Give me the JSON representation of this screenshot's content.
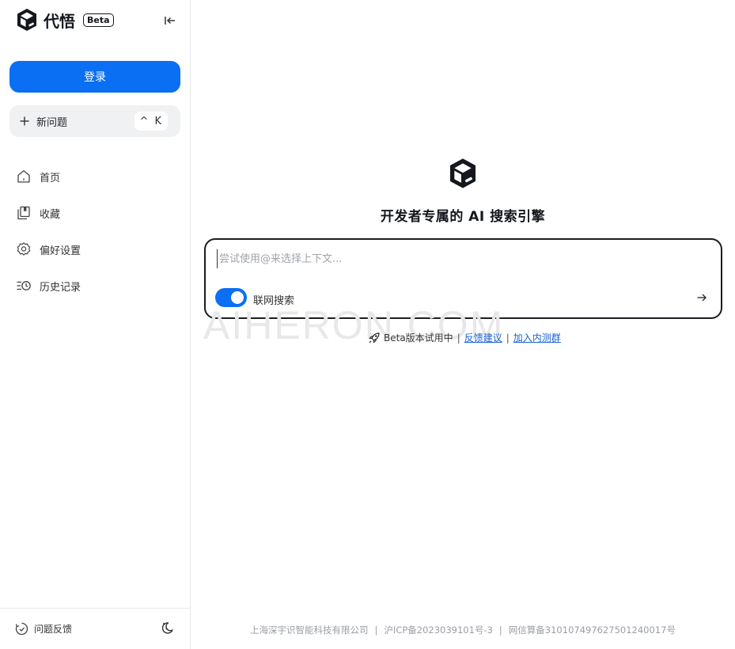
{
  "brand": {
    "name": "代悟",
    "badge": "Beta"
  },
  "sidebar": {
    "login_label": "登录",
    "new_question": {
      "label": "新问题",
      "shortcut": "^ K"
    },
    "nav": [
      {
        "label": "首页",
        "icon": "home-icon"
      },
      {
        "label": "收藏",
        "icon": "bookmark-icon"
      },
      {
        "label": "偏好设置",
        "icon": "gear-icon"
      },
      {
        "label": "历史记录",
        "icon": "history-icon"
      }
    ],
    "feedback_label": "问题反馈"
  },
  "main": {
    "headline": "开发者专属的 AI 搜索引擎",
    "search": {
      "placeholder": "尝试使用@来选择上下文...",
      "value": "",
      "web_search_label": "联网搜索",
      "web_search_on": true
    },
    "beta_notice": {
      "text": "Beta版本试用中",
      "feedback_link": "反馈建议",
      "join_link": "加入内测群"
    },
    "watermark": "AIHERON.COM"
  },
  "footer": {
    "company": "上海深宇识智能科技有限公司",
    "icp": "沪ICP备2023039101号-3",
    "record": "网信算备310107497627501240017号"
  },
  "colors": {
    "accent": "#0a6ff2",
    "link": "#1a63d6",
    "border": "#1a1d21"
  }
}
